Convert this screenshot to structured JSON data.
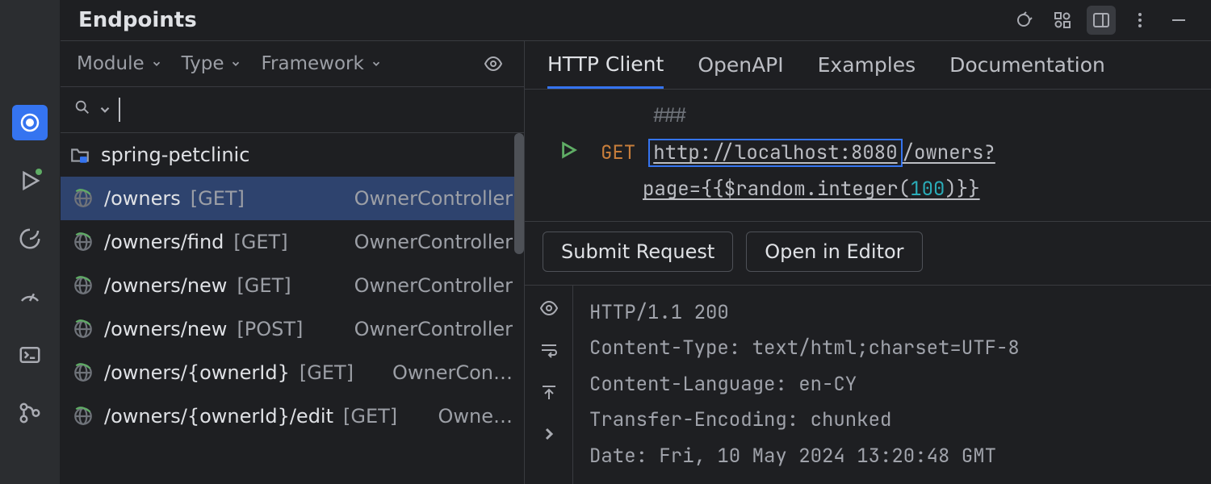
{
  "title": "Endpoints",
  "filters": {
    "module": "Module",
    "type": "Type",
    "framework": "Framework"
  },
  "project": "spring-petclinic",
  "tabs": [
    "HTTP Client",
    "OpenAPI",
    "Examples",
    "Documentation"
  ],
  "active_tab": 0,
  "endpoints": [
    {
      "path": "/owners",
      "method": "GET",
      "controller": "OwnerController",
      "selected": true
    },
    {
      "path": "/owners/find",
      "method": "GET",
      "controller": "OwnerController"
    },
    {
      "path": "/owners/new",
      "method": "GET",
      "controller": "OwnerController"
    },
    {
      "path": "/owners/new",
      "method": "POST",
      "controller": "OwnerController"
    },
    {
      "path": "/owners/{ownerId}",
      "method": "GET",
      "controller": "OwnerCon…"
    },
    {
      "path": "/owners/{ownerId}/edit",
      "method": "GET",
      "controller": "Owne…"
    }
  ],
  "request": {
    "hashes": "###",
    "method": "GET",
    "url_host": "http://localhost:8080",
    "url_path": "/owners?",
    "url_line2_pre": "page={{$random.integer(",
    "url_line2_num": "100",
    "url_line2_post": ")}}"
  },
  "buttons": {
    "submit": "Submit Request",
    "open": "Open in Editor"
  },
  "response": {
    "lines": [
      "HTTP/1.1 200",
      "Content-Type: text/html;charset=UTF-8",
      "Content-Language: en-CY",
      "Transfer-Encoding: chunked",
      "Date: Fri, 10 May 2024 13:20:48 GMT"
    ]
  }
}
